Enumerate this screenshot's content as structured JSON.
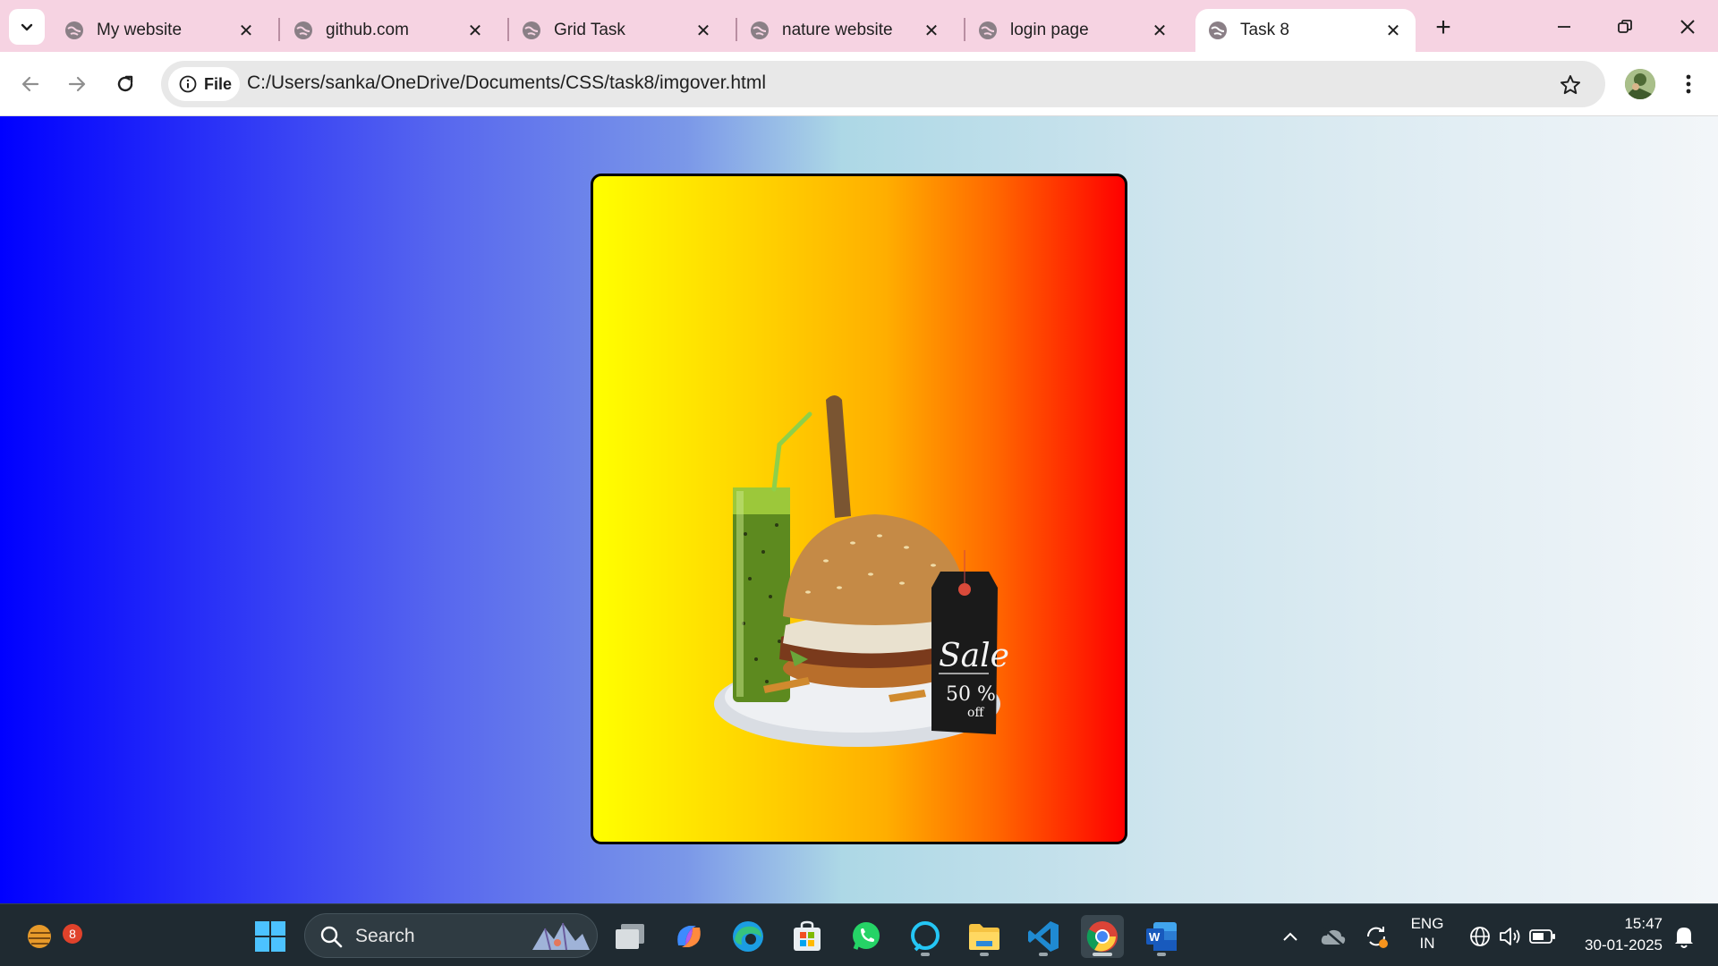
{
  "browser": {
    "tabs": [
      {
        "title": "My website",
        "active": false
      },
      {
        "title": "github.com",
        "active": false
      },
      {
        "title": "Grid Task",
        "active": false
      },
      {
        "title": "nature website",
        "active": false
      },
      {
        "title": "login page",
        "active": false
      },
      {
        "title": "Task 8",
        "active": true
      }
    ],
    "address_chip": "File",
    "url": "C:/Users/sanka/OneDrive/Documents/CSS/task8/imgover.html"
  },
  "page": {
    "background_gradient": [
      "#0000ff",
      "#add8e6",
      "#ffffff"
    ],
    "card_gradient": [
      "#ffff00",
      "#ffa500",
      "#ff0000"
    ],
    "card_border": "#000000",
    "image": {
      "description_icon": "burger-with-drink-icon",
      "sale_tag_line1": "Sale",
      "sale_tag_line2": "50 %",
      "sale_tag_line3": "off"
    }
  },
  "taskbar": {
    "weather_badge": "8",
    "search_label": "Search",
    "language_line1": "ENG",
    "language_line2": "IN",
    "time": "15:47",
    "date": "30-01-2025"
  }
}
